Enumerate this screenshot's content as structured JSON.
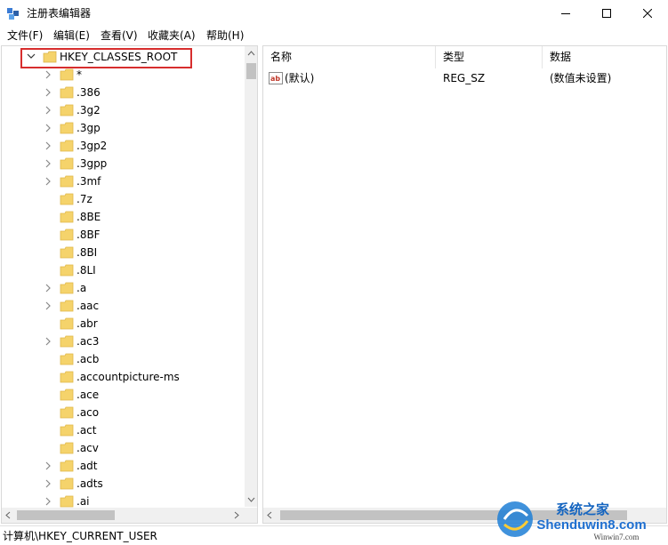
{
  "window": {
    "title": "注册表编辑器",
    "minimize_icon": "minimize-icon",
    "maximize_icon": "maximize-icon",
    "close_icon": "close-icon"
  },
  "menu": [
    "文件(F)",
    "编辑(E)",
    "查看(V)",
    "收藏夹(A)",
    "帮助(H)"
  ],
  "tree": {
    "root": {
      "label": "HKEY_CLASSES_ROOT",
      "expanded": true,
      "highlighted": true,
      "highlight_color": "#d72e2e"
    },
    "children": [
      {
        "label": "*",
        "expandable": true
      },
      {
        "label": ".386",
        "expandable": true
      },
      {
        "label": ".3g2",
        "expandable": true
      },
      {
        "label": ".3gp",
        "expandable": true
      },
      {
        "label": ".3gp2",
        "expandable": true
      },
      {
        "label": ".3gpp",
        "expandable": true
      },
      {
        "label": ".3mf",
        "expandable": true
      },
      {
        "label": ".7z",
        "expandable": false
      },
      {
        "label": ".8BE",
        "expandable": false
      },
      {
        "label": ".8BF",
        "expandable": false
      },
      {
        "label": ".8BI",
        "expandable": false
      },
      {
        "label": ".8LI",
        "expandable": false
      },
      {
        "label": ".a",
        "expandable": true
      },
      {
        "label": ".aac",
        "expandable": true
      },
      {
        "label": ".abr",
        "expandable": false
      },
      {
        "label": ".ac3",
        "expandable": true
      },
      {
        "label": ".acb",
        "expandable": false
      },
      {
        "label": ".accountpicture-ms",
        "expandable": false
      },
      {
        "label": ".ace",
        "expandable": false
      },
      {
        "label": ".aco",
        "expandable": false
      },
      {
        "label": ".act",
        "expandable": false
      },
      {
        "label": ".acv",
        "expandable": false
      },
      {
        "label": ".adt",
        "expandable": true
      },
      {
        "label": ".adts",
        "expandable": true
      },
      {
        "label": ".ai",
        "expandable": true
      }
    ]
  },
  "values": {
    "columns": {
      "name": "名称",
      "type": "类型",
      "data": "数据"
    },
    "rows": [
      {
        "icon": "string-value-icon",
        "name": "(默认)",
        "type": "REG_SZ",
        "data": "(数值未设置)"
      }
    ]
  },
  "status": {
    "path": "计算机\\HKEY_CURRENT_USER"
  },
  "watermark": {
    "brand": "Shenduwin8.com",
    "url": "Winwin7.com",
    "cn": "系统之家"
  },
  "colors": {
    "folder": "#f5d36b",
    "folder_dark": "#e0b84a",
    "highlight": "#d72e2e"
  }
}
